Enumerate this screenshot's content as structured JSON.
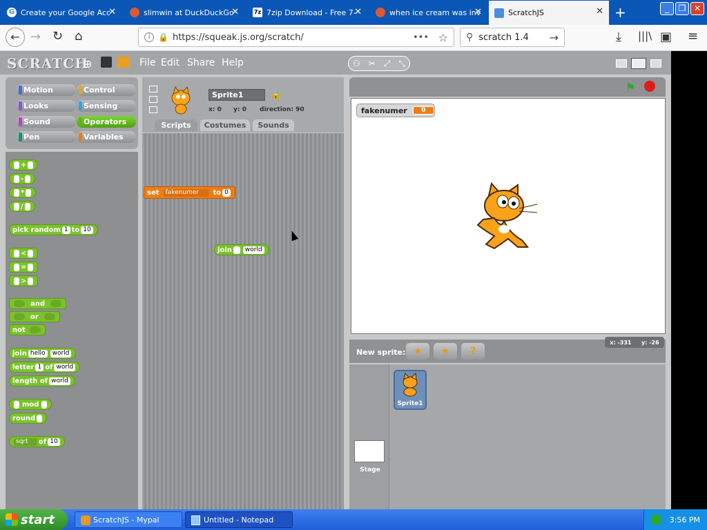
{
  "browser": {
    "tabs": [
      {
        "label": "Create your Google Acc",
        "icon": "google-icon"
      },
      {
        "label": "slimwin at DuckDuckGo",
        "icon": "duckduckgo-icon"
      },
      {
        "label": "7zip Download - Free 7-",
        "icon": "7zip-icon"
      },
      {
        "label": "when ice cream was inv",
        "icon": "duckduckgo-icon"
      },
      {
        "label": "ScratchJS",
        "icon": "scratch-icon"
      }
    ],
    "new_tab": "+",
    "url": "https://squeak.js.org/scratch/",
    "search": "scratch 1.4",
    "url_more": "•••"
  },
  "scratch": {
    "logo": "SCRATCH",
    "menus": [
      "File",
      "Edit",
      "Share",
      "Help"
    ],
    "categories": [
      {
        "label": "Motion",
        "color": "#4a6cd4"
      },
      {
        "label": "Control",
        "color": "#e1a91a"
      },
      {
        "label": "Looks",
        "color": "#8a55d7"
      },
      {
        "label": "Sensing",
        "color": "#2ca5e2"
      },
      {
        "label": "Sound",
        "color": "#bb42c3"
      },
      {
        "label": "Operators",
        "color": "#5cb712"
      },
      {
        "label": "Pen",
        "color": "#0e9a6c"
      },
      {
        "label": "Variables",
        "color": "#ee7d16"
      }
    ],
    "blocks": {
      "plus": "+",
      "minus": "-",
      "times": "*",
      "divide": "/",
      "pick_random": "pick random",
      "pick_from": "1",
      "pick_to_word": "to",
      "pick_to": "10",
      "lt": "<",
      "eq": "=",
      "gt": ">",
      "and": "and",
      "or": "or",
      "not": "not",
      "join": "join",
      "join_a": "hello",
      "join_b": "world",
      "letter": "letter",
      "letter_n": "1",
      "letter_of": "of",
      "letter_s": "world",
      "length": "length of",
      "length_s": "world",
      "mod": "mod",
      "round": "round",
      "sqrt": "sqrt",
      "sqrt_of": "of",
      "sqrt_v": "10"
    },
    "sprite": {
      "name": "Sprite1",
      "x": "x: 0",
      "y": "y: 0",
      "direction": "direction: 90"
    },
    "tabs": [
      "Scripts",
      "Costumes",
      "Sounds"
    ],
    "script_set": {
      "set": "set",
      "var": "fakenumer",
      "to": "to",
      "value": "0"
    },
    "script_join": {
      "join": "join",
      "a": "",
      "b": "world"
    },
    "monitor": {
      "label": "fakenumer",
      "value": "0"
    },
    "new_sprite_label": "New sprite:",
    "coords": {
      "x": "x: -331",
      "y": "y: -26"
    },
    "sprite_thumb": "Sprite1",
    "stage_thumb": "Stage"
  },
  "taskbar": {
    "start": "start",
    "tasks": [
      {
        "label": "ScratchJS - Mypal"
      },
      {
        "label": "Untitled - Notepad"
      }
    ],
    "clock": "3:56 PM"
  }
}
